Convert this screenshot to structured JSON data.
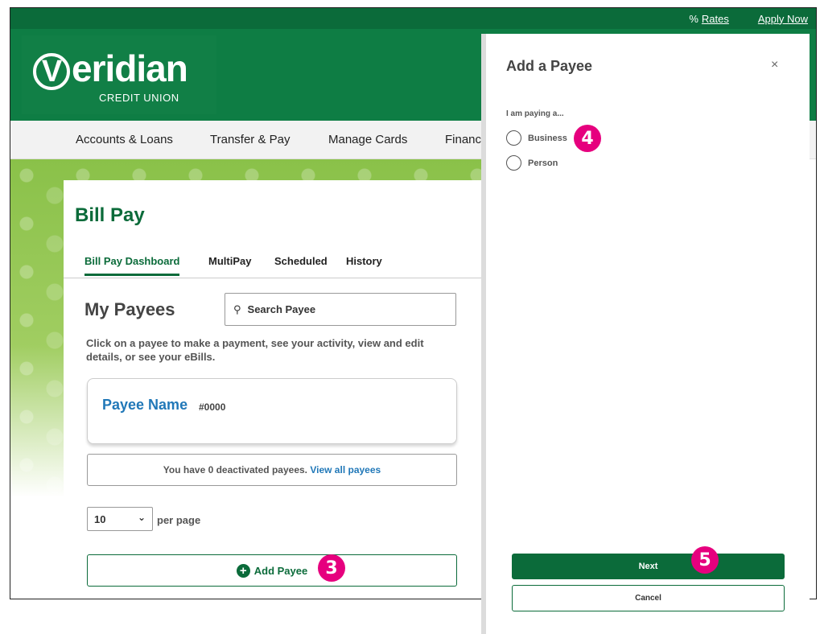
{
  "top_links": {
    "rates_prefix": "%",
    "rates": "Rates",
    "apply": "Apply Now"
  },
  "logo": {
    "v_glyph": "V",
    "name": "eridian",
    "subtitle": "CREDIT UNION"
  },
  "nav": {
    "items": [
      "Accounts & Loans",
      "Transfer & Pay",
      "Manage Cards",
      "Financi"
    ]
  },
  "page": {
    "title": "Bill Pay",
    "tabs": [
      "Bill Pay Dashboard",
      "MultiPay",
      "Scheduled",
      "History"
    ],
    "payees_heading": "My Payees",
    "search_placeholder": "Search Payee",
    "instructions": "Click on a payee to make a payment, see your activity, view and edit details, or see your eBills.",
    "payee": {
      "name": "Payee Name",
      "number": "#0000"
    },
    "deactivated": {
      "text": "You have 0 deactivated payees.",
      "link": "View all payees"
    },
    "per_page": {
      "value": "10",
      "label": "per page"
    },
    "add_payee": "Add Payee"
  },
  "panel": {
    "title": "Add a Payee",
    "close": "×",
    "paying_label": "I am paying a...",
    "options": [
      "Business",
      "Person"
    ],
    "next": "Next",
    "cancel": "Cancel"
  },
  "callouts": {
    "add_payee_step": "3",
    "business_step": "4",
    "next_step": "5"
  },
  "colors": {
    "brand_green": "#0b6b3a",
    "link_blue": "#2178b8",
    "callout_pink": "#e6007e"
  }
}
